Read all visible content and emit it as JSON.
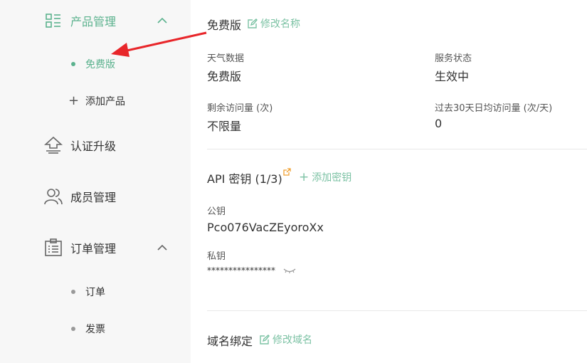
{
  "sidebar": {
    "product_mgmt": "产品管理",
    "free_tier": "免费版",
    "add_product": "添加产品",
    "cert_upgrade": "认证升级",
    "members": "成员管理",
    "orders_mgmt": "订单管理",
    "orders": "订单",
    "invoices": "发票"
  },
  "plan": {
    "title": "免费版",
    "rename_link": "修改名称",
    "weather_label": "天气数据",
    "weather_value": "免费版",
    "status_label": "服务状态",
    "status_value": "生效中",
    "remaining_label": "剩余访问量 (次)",
    "remaining_value": "不限量",
    "avg_label": "过去30天日均访问量 (次/天)",
    "avg_value": "0"
  },
  "api": {
    "title": "API 密钥 (1/3)",
    "add_key": "添加密钥",
    "public_label": "公钥",
    "public_value": "Pco076VacZEyoroXx",
    "private_label": "私钥",
    "private_value": "****************"
  },
  "domain": {
    "title": "域名绑定",
    "edit_link": "修改域名"
  },
  "colors": {
    "accent": "#5bb28e",
    "arrow": "#e8262a",
    "link_orange": "#f0a030"
  }
}
